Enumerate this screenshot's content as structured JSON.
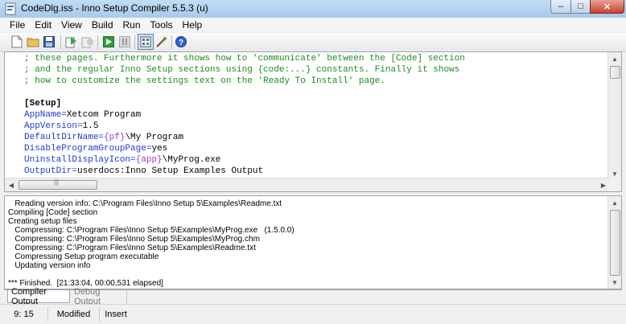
{
  "window": {
    "title": "CodeDlg.iss - Inno Setup Compiler 5.5.3 (u)",
    "controls": {
      "minimize": "–",
      "maximize": "□",
      "close": "✕"
    }
  },
  "menu": [
    "File",
    "Edit",
    "View",
    "Build",
    "Run",
    "Tools",
    "Help"
  ],
  "toolbar": {
    "buttons": [
      "new-icon",
      "open-folder-icon",
      "save-icon",
      "compile-icon",
      "stop-compile-icon",
      "run-icon",
      "pause-icon",
      "target-icon",
      "wizard-icon",
      "help-icon"
    ]
  },
  "editor": {
    "comment_lines": [
      "; these pages. Furthermore it shows how to 'communicate' between the [Code] section",
      "; and the regular Inno Setup sections using {code:...} constants. Finally it shows",
      "; how to customize the settings text on the 'Ready To Install' page."
    ],
    "section": "[Setup]",
    "directives": [
      {
        "key": "AppName",
        "eq": "=",
        "value": "Xetcom Program"
      },
      {
        "key": "AppVersion",
        "eq": "=",
        "value": "1.5"
      },
      {
        "key": "DefaultDirName",
        "eq": "=",
        "const": "{pf}",
        "value": "\\My Program"
      },
      {
        "key": "DisableProgramGroupPage",
        "eq": "=",
        "value": "yes"
      },
      {
        "key": "UninstallDisplayIcon",
        "eq": "=",
        "const": "{app}",
        "value": "\\MyProg.exe"
      },
      {
        "key": "OutputDir",
        "eq": "=",
        "value": "userdocs:Inno Setup Examples Output"
      }
    ],
    "scroll_grip": "|||"
  },
  "output": {
    "lines": [
      "   Reading version info: C:\\Program Files\\Inno Setup 5\\Examples\\Readme.txt",
      "Compiling [Code] section",
      "Creating setup files",
      "   Compressing: C:\\Program Files\\Inno Setup 5\\Examples\\MyProg.exe   (1.5.0.0)",
      "   Compressing: C:\\Program Files\\Inno Setup 5\\Examples\\MyProg.chm",
      "   Compressing: C:\\Program Files\\Inno Setup 5\\Examples\\Readme.txt",
      "   Compressing Setup program executable",
      "   Updating version info",
      "",
      "*** Finished.  [21:33:04, 00:00,531 elapsed]"
    ]
  },
  "tabs": {
    "compiler": "Compiler Output",
    "debug": "Debug Output"
  },
  "status": {
    "position": "9: 15",
    "modified": "Modified",
    "mode": "Insert"
  },
  "colors": {
    "comment": "#1e8b1e",
    "key": "#1c3ad6",
    "constant": "#9b3dc9"
  }
}
